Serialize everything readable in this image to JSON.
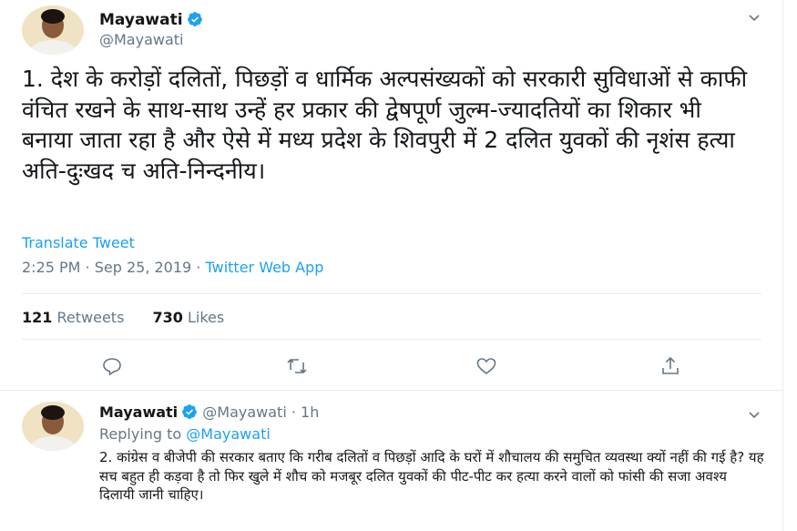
{
  "tweet": {
    "author_name": "Mayawati",
    "author_handle": "@Mayawati",
    "text": "1. देश के करोड़ों दलितों, पिछड़ों व धार्मिक अल्पसंख्यकों को सरकारी सुविधाओं से काफी वंचित रखने के साथ-साथ उन्हें हर प्रकार की द्वेषपूर्ण जुल्म-ज्यादतियों का शिकार भी बनाया जाता रहा है और ऐसे में मध्य प्रदेश के शिवपुरी में 2 दलित युवकों की नृशंस हत्या अति-दुःखद च अति-निन्दनीय।",
    "translate_label": "Translate Tweet",
    "timestamp": "2:25 PM · Sep 25, 2019 · ",
    "source_app": "Twitter Web App",
    "retweets_count": "121",
    "retweets_label": "Retweets",
    "likes_count": "730",
    "likes_label": "Likes"
  },
  "actions": {
    "reply_icon": "reply-icon",
    "retweet_icon": "retweet-icon",
    "like_icon": "heart-icon",
    "share_icon": "share-icon"
  },
  "reply": {
    "author_name": "Mayawati",
    "author_handle_time": "@Mayawati · 1h",
    "replying_prefix": "Replying to ",
    "replying_to": "@Mayawati",
    "text": "2. कांग्रेस व बीजेपी की सरकार बताए कि गरीब दलितों व पिछड़ों आदि के घरों में शौचालय की समुचित व्यवस्था क्यों नहीं की गई है? यह सच बहुत ही कड़वा है तो फिर खुले में शौच को मजबूर दलित युवकों की पीट-पीट कर हत्या करने वालों को फांसी की सजा अवश्य दिलायी जानी चाहिए।"
  },
  "colors": {
    "accent": "#1da1f2",
    "muted": "#657786",
    "text": "#14171a"
  }
}
